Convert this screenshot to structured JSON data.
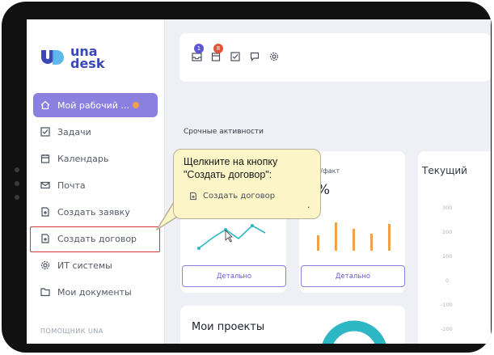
{
  "logo": {
    "line1": "una",
    "line2": "desk"
  },
  "sidebar": {
    "items": [
      {
        "label": "Мой рабочий ...",
        "icon": "home-icon"
      },
      {
        "label": "Задачи",
        "icon": "tasks-icon"
      },
      {
        "label": "Календарь",
        "icon": "calendar-icon"
      },
      {
        "label": "Почта",
        "icon": "mail-icon"
      },
      {
        "label": "Создать заявку",
        "icon": "new-request-icon"
      },
      {
        "label": "Создать договор",
        "icon": "new-contract-icon"
      },
      {
        "label": "ИТ системы",
        "icon": "it-systems-icon"
      },
      {
        "label": "Мои документы",
        "icon": "documents-icon"
      }
    ],
    "section": "ПОМОЩНИК UNA"
  },
  "topbar": {
    "badges": [
      "1",
      "8"
    ]
  },
  "main": {
    "section_title": "Срочные активности",
    "card2_title": "лан/факт",
    "card2_value": "0%",
    "card3_title": "Текущий",
    "detail_label": "Детально",
    "projects_title": "Мои проекты",
    "y_ticks": [
      "300",
      "200",
      "100",
      "0",
      "-100",
      "-200"
    ]
  },
  "callout": {
    "text_line1": "Щелкните на кнопку",
    "text_line2": "\"Создать договор\":",
    "button_label": "Создать договор",
    "dot": "."
  },
  "colors": {
    "accent": "#8b7fe0",
    "highlight": "#d33a3a",
    "bar": "#f0a24a",
    "line": "#2db6c4",
    "callout_bg": "#fbf5c7"
  }
}
